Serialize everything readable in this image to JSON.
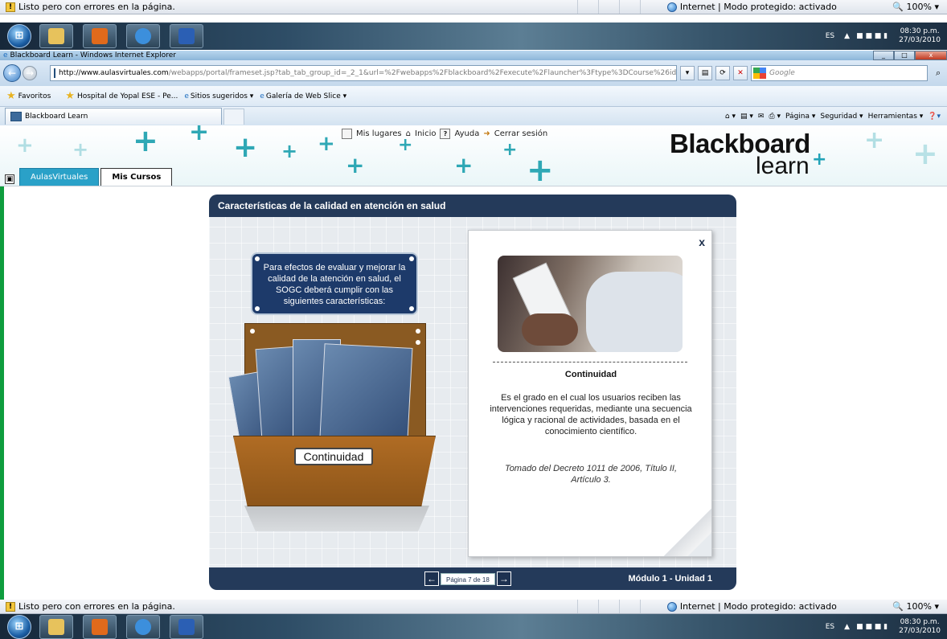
{
  "ie": {
    "status_text": "Listo pero con errores en la página.",
    "zone_text": "Internet | Modo protegido: activado",
    "zoom": "100%",
    "window_title": "Blackboard Learn - Windows Internet Explorer",
    "address_host": "http://www.aulasvirtuales.com",
    "address_path": "/webapps/portal/frameset.jsp?tab_tab_group_id=_2_1&url=%2Fwebapps%2Fblackboard%2Fexecute%2Flauncher%3Ftype%3DCourse%26id%3D_1(",
    "search_placeholder": "Google",
    "favorites": {
      "label": "Favoritos",
      "link1": "Hospital de Yopal ESE - Pe...",
      "link2": "Sitios sugeridos ▾",
      "link3": "Galería de Web Slice ▾"
    },
    "tab_label": "Blackboard Learn",
    "commands": {
      "page": "Página ▾",
      "security": "Seguridad ▾",
      "tools": "Herramientas ▾"
    }
  },
  "taskbar": {
    "lang": "ES",
    "time": "08:30 p.m.",
    "date": "27/03/2010",
    "orb_label": "⊞"
  },
  "blackboard": {
    "nav": {
      "places": "Mis lugares",
      "home": "Inicio",
      "help": "Ayuda",
      "logout": "Cerrar sesión"
    },
    "tab_aulas": "AulasVirtuales",
    "tab_cursos": "Mis Cursos",
    "logo_top": "Blackboard",
    "logo_bottom": "learn",
    "logo_plus": "+"
  },
  "module": {
    "title": "Características de la calidad en atención en salud",
    "intro": "Para efectos de evaluar y mejorar la calidad de la atención en salud, el SOGC deberá cumplir con las siguientes características:",
    "button_label": "Continuidad",
    "close_label": "x",
    "card_title": "Continuidad",
    "card_body": "Es el grado en el cual los usuarios reciben las intervenciones requeridas, mediante una secuencia lógica y racional de actividades, basada en el conocimiento científico.",
    "card_source": "Tomado del Decreto 1011 de 2006, Título II, Artículo 3.",
    "pager": "Página 7 de 18",
    "prev": "←",
    "next": "→",
    "unit": "Módulo 1 - Unidad 1"
  }
}
